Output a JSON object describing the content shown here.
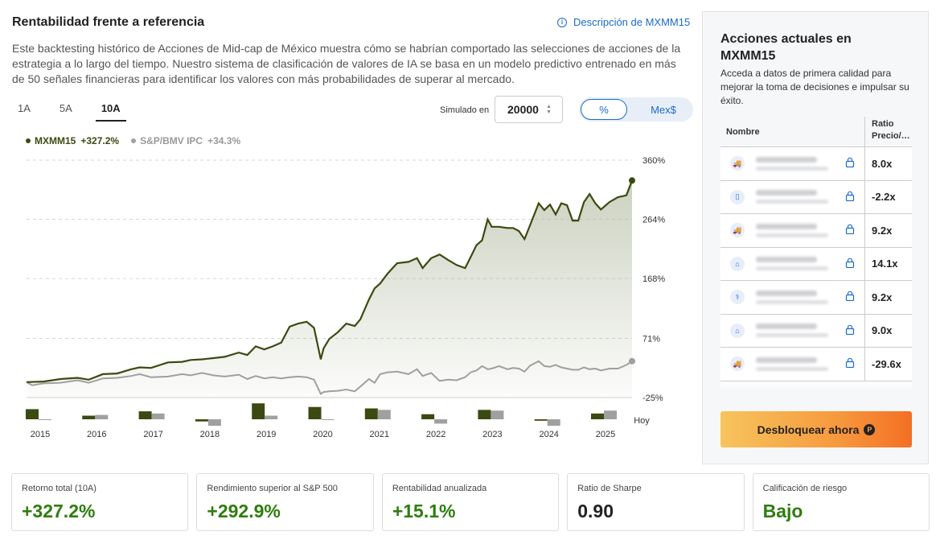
{
  "header": {
    "title": "Rentabilidad frente a referencia",
    "desc_link": "Descripción de MXMM15",
    "intro": "Este backtesting histórico de Acciones de Mid-cap de México muestra cómo se habrían comportado las selecciones de acciones de la estrategia a lo largo del tiempo. Nuestro sistema de clasificación de valores de IA se basa en un modelo predictivo entrenado en más de 50 señales financieras para identificar los valores con más probabilidades de superar al mercado."
  },
  "tabs": [
    "1A",
    "5A",
    "10A"
  ],
  "active_tab": "10A",
  "simulator": {
    "label": "Simulado en",
    "value": "20000"
  },
  "toggle": {
    "pct": "%",
    "mxn": "Mex$"
  },
  "legend": {
    "a_name": "MXMM15",
    "a_ret": "+327.2%",
    "b_name": "S&P/BMV IPC",
    "b_ret": "+34.3%"
  },
  "colors": {
    "strategy": "#3b4a10",
    "benchmark": "#a0a0a0",
    "accent": "#1a6bcc",
    "positive": "#2e7d0e"
  },
  "chart_data": {
    "type": "line",
    "y_ticks": [
      "360%",
      "264%",
      "168%",
      "71%",
      "-25%"
    ],
    "y_tick_values": [
      360,
      264,
      168,
      71,
      -25
    ],
    "ylim": [
      -25,
      360
    ],
    "x_labels": [
      "2015",
      "2016",
      "2017",
      "2018",
      "2019",
      "2020",
      "2021",
      "2022",
      "2023",
      "2024",
      "2025",
      "Hoy"
    ],
    "series": [
      {
        "name": "MXMM15",
        "points": [
          [
            2015.0,
            0
          ],
          [
            2015.3,
            1
          ],
          [
            2015.6,
            5
          ],
          [
            2015.9,
            7
          ],
          [
            2016.1,
            4
          ],
          [
            2016.35,
            13
          ],
          [
            2016.6,
            14
          ],
          [
            2016.85,
            21
          ],
          [
            2017.0,
            24
          ],
          [
            2017.2,
            23
          ],
          [
            2017.5,
            32
          ],
          [
            2017.75,
            33
          ],
          [
            2017.9,
            36
          ],
          [
            2018.1,
            37
          ],
          [
            2018.3,
            39
          ],
          [
            2018.5,
            41
          ],
          [
            2018.75,
            48
          ],
          [
            2018.9,
            44
          ],
          [
            2019.05,
            58
          ],
          [
            2019.2,
            53
          ],
          [
            2019.35,
            58
          ],
          [
            2019.5,
            64
          ],
          [
            2019.65,
            90
          ],
          [
            2019.8,
            95
          ],
          [
            2019.95,
            98
          ],
          [
            2020.08,
            88
          ],
          [
            2020.2,
            37
          ],
          [
            2020.25,
            55
          ],
          [
            2020.35,
            70
          ],
          [
            2020.5,
            81
          ],
          [
            2020.65,
            95
          ],
          [
            2020.8,
            91
          ],
          [
            2020.9,
            102
          ],
          [
            2021.05,
            134
          ],
          [
            2021.15,
            152
          ],
          [
            2021.25,
            160
          ],
          [
            2021.38,
            176
          ],
          [
            2021.55,
            193
          ],
          [
            2021.75,
            195
          ],
          [
            2021.9,
            201
          ],
          [
            2022.0,
            185
          ],
          [
            2022.15,
            201
          ],
          [
            2022.3,
            207
          ],
          [
            2022.45,
            198
          ],
          [
            2022.6,
            190
          ],
          [
            2022.75,
            185
          ],
          [
            2022.85,
            203
          ],
          [
            2022.95,
            222
          ],
          [
            2023.05,
            230
          ],
          [
            2023.15,
            264
          ],
          [
            2023.22,
            252
          ],
          [
            2023.35,
            252
          ],
          [
            2023.5,
            250
          ],
          [
            2023.6,
            250
          ],
          [
            2023.7,
            245
          ],
          [
            2023.8,
            232
          ],
          [
            2023.9,
            255
          ],
          [
            2024.05,
            290
          ],
          [
            2024.15,
            279
          ],
          [
            2024.25,
            288
          ],
          [
            2024.35,
            272
          ],
          [
            2024.45,
            290
          ],
          [
            2024.55,
            287
          ],
          [
            2024.65,
            262
          ],
          [
            2024.75,
            262
          ],
          [
            2024.85,
            292
          ],
          [
            2024.95,
            305
          ],
          [
            2025.05,
            290
          ],
          [
            2025.15,
            280
          ],
          [
            2025.3,
            292
          ],
          [
            2025.45,
            300
          ],
          [
            2025.6,
            303
          ],
          [
            2025.7,
            327
          ]
        ]
      },
      {
        "name": "S&P/BMV IPC",
        "points": [
          [
            2015.0,
            0
          ],
          [
            2015.1,
            -5
          ],
          [
            2015.3,
            -2
          ],
          [
            2015.6,
            -1
          ],
          [
            2015.9,
            3
          ],
          [
            2016.1,
            -1
          ],
          [
            2016.35,
            6
          ],
          [
            2016.6,
            7
          ],
          [
            2016.85,
            10
          ],
          [
            2017.0,
            13
          ],
          [
            2017.2,
            8
          ],
          [
            2017.5,
            9
          ],
          [
            2017.75,
            13
          ],
          [
            2017.9,
            11
          ],
          [
            2018.1,
            15
          ],
          [
            2018.3,
            11
          ],
          [
            2018.5,
            9
          ],
          [
            2018.75,
            12
          ],
          [
            2018.9,
            5
          ],
          [
            2019.05,
            10
          ],
          [
            2019.2,
            6
          ],
          [
            2019.35,
            8
          ],
          [
            2019.5,
            6
          ],
          [
            2019.65,
            8
          ],
          [
            2019.8,
            9
          ],
          [
            2019.95,
            8
          ],
          [
            2020.08,
            4
          ],
          [
            2020.2,
            -19
          ],
          [
            2020.25,
            -16
          ],
          [
            2020.35,
            -15
          ],
          [
            2020.5,
            -14
          ],
          [
            2020.65,
            -12
          ],
          [
            2020.8,
            -15
          ],
          [
            2020.9,
            -7
          ],
          [
            2021.05,
            5
          ],
          [
            2021.15,
            -1
          ],
          [
            2021.25,
            13
          ],
          [
            2021.38,
            16
          ],
          [
            2021.55,
            17
          ],
          [
            2021.75,
            13
          ],
          [
            2021.9,
            21
          ],
          [
            2022.0,
            10
          ],
          [
            2022.15,
            15
          ],
          [
            2022.3,
            2
          ],
          [
            2022.45,
            4
          ],
          [
            2022.6,
            3
          ],
          [
            2022.75,
            8
          ],
          [
            2022.85,
            16
          ],
          [
            2022.95,
            19
          ],
          [
            2023.05,
            26
          ],
          [
            2023.15,
            21
          ],
          [
            2023.22,
            22
          ],
          [
            2023.35,
            26
          ],
          [
            2023.5,
            21
          ],
          [
            2023.6,
            23
          ],
          [
            2023.7,
            22
          ],
          [
            2023.8,
            17
          ],
          [
            2023.9,
            27
          ],
          [
            2024.05,
            34
          ],
          [
            2024.15,
            26
          ],
          [
            2024.25,
            25
          ],
          [
            2024.35,
            28
          ],
          [
            2024.45,
            24
          ],
          [
            2024.55,
            22
          ],
          [
            2024.65,
            20
          ],
          [
            2024.75,
            20
          ],
          [
            2024.85,
            24
          ],
          [
            2024.95,
            21
          ],
          [
            2025.05,
            22
          ],
          [
            2025.15,
            19
          ],
          [
            2025.3,
            22
          ],
          [
            2025.45,
            22
          ],
          [
            2025.6,
            28
          ],
          [
            2025.7,
            34
          ]
        ]
      }
    ],
    "annual_bars": [
      {
        "year": "2015",
        "strategy": 14,
        "benchmark": -1
      },
      {
        "year": "2016",
        "strategy": 5,
        "benchmark": 6
      },
      {
        "year": "2017",
        "strategy": 11,
        "benchmark": 8
      },
      {
        "year": "2018",
        "strategy": -3,
        "benchmark": -9
      },
      {
        "year": "2019",
        "strategy": 22,
        "benchmark": 5
      },
      {
        "year": "2020",
        "strategy": 17,
        "benchmark": -1
      },
      {
        "year": "2021",
        "strategy": 15,
        "benchmark": 13
      },
      {
        "year": "2022",
        "strategy": 7,
        "benchmark": -6
      },
      {
        "year": "2023",
        "strategy": 13,
        "benchmark": 12
      },
      {
        "year": "2024",
        "strategy": -2,
        "benchmark": -9
      },
      {
        "year": "2025",
        "strategy": 8,
        "benchmark": 12
      }
    ]
  },
  "sidebar": {
    "title": "Acciones actuales en MXMM15",
    "desc": "Acceda a datos de primera calidad para mejorar la toma de decisiones e impulsar su éxito.",
    "col_name": "Nombre",
    "col_ratio": "Ratio Precio/…",
    "rows": [
      {
        "icon": "truck-icon",
        "glyph": "🚚",
        "ratio": "8.0x"
      },
      {
        "icon": "phone-icon",
        "glyph": "▯",
        "ratio": "-2.2x"
      },
      {
        "icon": "truck-icon",
        "glyph": "🚚",
        "ratio": "9.2x"
      },
      {
        "icon": "bank-icon",
        "glyph": "⌂",
        "ratio": "14.1x"
      },
      {
        "icon": "health-icon",
        "glyph": "⚕",
        "ratio": "9.2x"
      },
      {
        "icon": "bank-icon",
        "glyph": "⌂",
        "ratio": "9.0x"
      },
      {
        "icon": "truck-icon",
        "glyph": "🚚",
        "ratio": "-29.6x"
      }
    ],
    "cta": "Desbloquear ahora"
  },
  "stats": [
    {
      "label": "Retorno total (10A)",
      "value": "+327.2%",
      "tone": "green"
    },
    {
      "label": "Rendimiento superior al S&P 500",
      "value": "+292.9%",
      "tone": "green"
    },
    {
      "label": "Rentabilidad anualizada",
      "value": "+15.1%",
      "tone": "green"
    },
    {
      "label": "Ratio de Sharpe",
      "value": "0.90",
      "tone": "dark"
    },
    {
      "label": "Calificación de riesgo",
      "value": "Bajo",
      "tone": "green"
    }
  ]
}
